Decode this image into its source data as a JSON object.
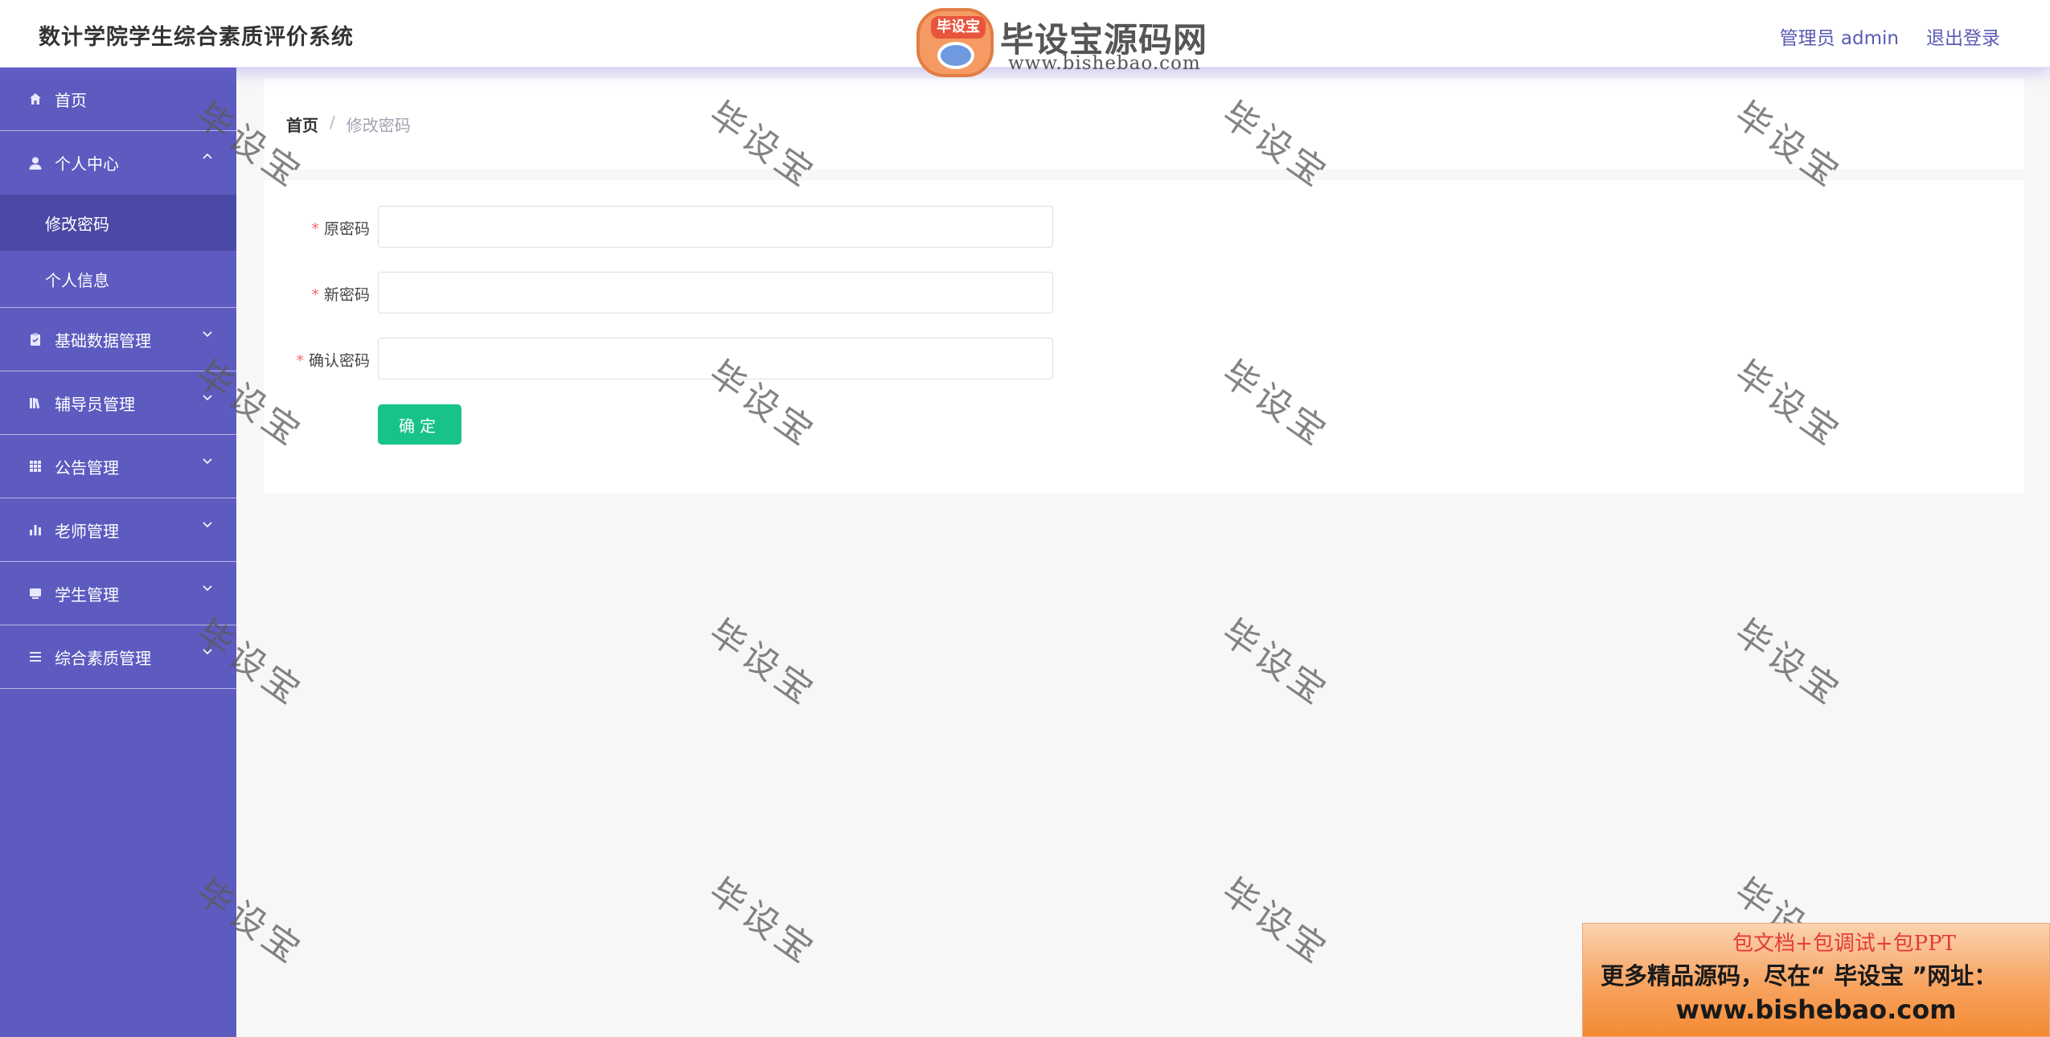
{
  "header": {
    "title": "数计学院学生综合素质评价系统",
    "user_label": "管理员 admin",
    "logout_label": "退出登录"
  },
  "logo": {
    "badge_text": "毕设宝",
    "title": "毕设宝源码网",
    "url": "www.bishebao.com"
  },
  "sidebar": {
    "items": [
      {
        "label": "首页",
        "icon": "home-icon"
      },
      {
        "label": "个人中心",
        "icon": "user-icon",
        "expanded": true,
        "children": [
          {
            "label": "修改密码",
            "active": true
          },
          {
            "label": "个人信息",
            "active": false
          }
        ]
      },
      {
        "label": "基础数据管理",
        "icon": "clipboard-icon"
      },
      {
        "label": "辅导员管理",
        "icon": "book-icon"
      },
      {
        "label": "公告管理",
        "icon": "grid-icon"
      },
      {
        "label": "老师管理",
        "icon": "bar-chart-icon"
      },
      {
        "label": "学生管理",
        "icon": "monitor-icon"
      },
      {
        "label": "综合素质管理",
        "icon": "list-icon"
      }
    ]
  },
  "breadcrumb": {
    "home": "首页",
    "separator": "/",
    "current": "修改密码"
  },
  "form": {
    "old_password_label": "原密码",
    "new_password_label": "新密码",
    "confirm_password_label": "确认密码",
    "required_mark": "*",
    "old_password_value": "",
    "new_password_value": "",
    "confirm_password_value": "",
    "submit_label": "确定"
  },
  "watermark_text": "毕设宝",
  "ad": {
    "line1": "包文档+包调试+包PPT",
    "line2": "更多精品源码，尽在“ 毕设宝 ”网址：",
    "line3": "www.bishebao.com"
  },
  "colors": {
    "sidebar_bg": "#5d5bc0",
    "sidebar_active": "#4b49a6",
    "accent_green": "#18c28b",
    "required_red": "#f56c6c",
    "header_link": "#5a5ab5"
  }
}
